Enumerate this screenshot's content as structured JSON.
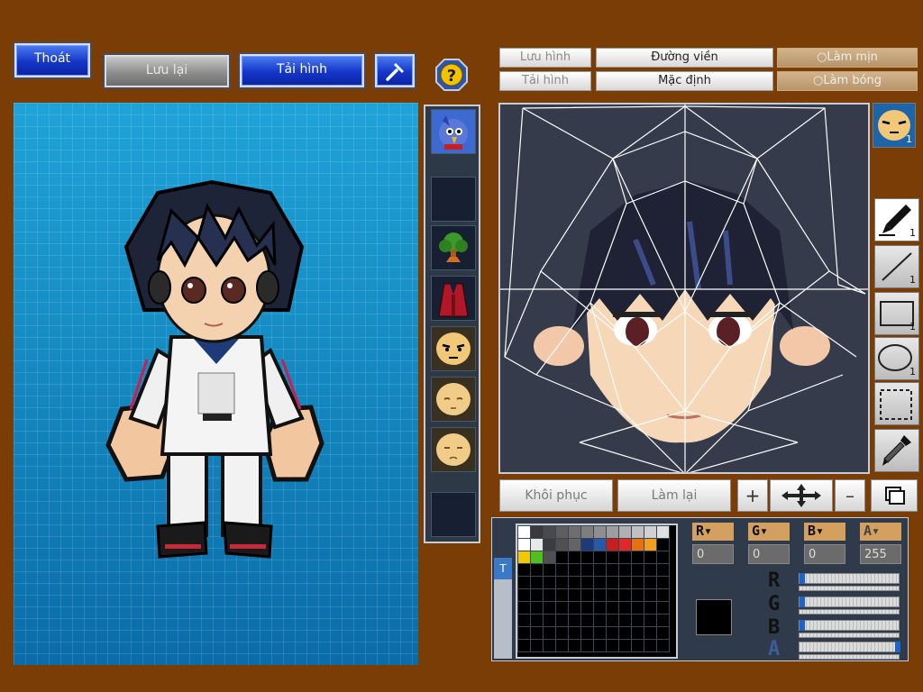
{
  "top_buttons": {
    "exit": "Thoát",
    "save": "Lưu lại",
    "load": "Tải hình"
  },
  "edit_toolbar": {
    "save_image": "Lưu hình",
    "load_image": "Tải hình",
    "outline": "Đường viền",
    "default": "Mặc định",
    "smooth": "Làm mịn",
    "shine": "Làm bóng"
  },
  "bottom_buttons": {
    "restore": "Khôi phục",
    "redo": "Làm lại"
  },
  "tool_counts": {
    "face_badge": "1",
    "brush": "1",
    "line": "1",
    "rect": "1",
    "ellipse": "1"
  },
  "color_channels": {
    "r_value": "0",
    "g_value": "0",
    "b_value": "0",
    "a_value": "255",
    "r_slider_fraction": 0.0,
    "g_slider_fraction": 0.0,
    "b_slider_fraction": 0.0,
    "a_slider_fraction": 1.0
  },
  "palette_colors": [
    "#ffffff",
    "#3a3a3a",
    "#4a4a4a",
    "#5e5e5e",
    "#6e6e6e",
    "#7e7e7e",
    "#8e8e8e",
    "#9e9e9e",
    "#b0b0b0",
    "#c0c0c0",
    "#d0d0d0",
    "#e0e0e0",
    "#ffffff",
    "#e8e8e8",
    "#3c3c3c",
    "#505050",
    "#646464",
    "#1e3a78",
    "#2858a8",
    "#c81e1e",
    "#e02828",
    "#e87010",
    "#f0a020",
    "#000000",
    "#f0c800",
    "#50c020",
    "#505050"
  ],
  "current_color": "#000000",
  "icon_names": [
    "help-icon",
    "hammer-icon",
    "face-icon",
    "brush-icon",
    "line-icon",
    "rect-icon",
    "ellipse-icon",
    "select-icon",
    "eyedropper-icon",
    "move-icon",
    "plus-icon",
    "minus-icon",
    "layers-icon"
  ]
}
